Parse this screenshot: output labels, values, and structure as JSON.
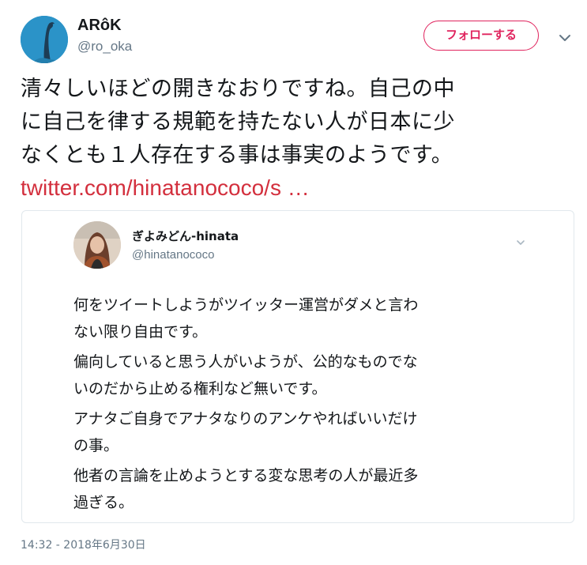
{
  "author": {
    "display_name": "ARôK",
    "handle": "@ro_oka"
  },
  "follow_button": {
    "label": "フォローする",
    "color": "#e0245e"
  },
  "tweet": {
    "text_lines": [
      "清々しいほどの開きなおりですね。自己の中",
      "に自己を律する規範を持たない人が日本に少",
      "なくとも１人存在する事は事実のようです。"
    ],
    "link": "twitter.com/hinatanococo/s …",
    "link_color": "#d32f3d",
    "timestamp": "14:32 - 2018年6月30日"
  },
  "quoted_tweet": {
    "display_name": "ぎよみどん-hinata",
    "handle": "@hinatanococo",
    "paragraphs": [
      [
        "何をツイートしようがツイッター運営がダメと言わ",
        "ない限り自由です。"
      ],
      [
        "偏向していると思う人がいようが、公的なものでな",
        "いのだから止める権利など無いです。"
      ],
      [
        "アナタご自身でアナタなりのアンケやればいいだけ",
        "の事。"
      ],
      [
        "他者の言論を止めようとする変な思考の人が最近多",
        "過ぎる。"
      ]
    ]
  },
  "icons": {
    "more_menu": "chevron-down-icon",
    "quote_menu": "chevron-down-icon"
  }
}
